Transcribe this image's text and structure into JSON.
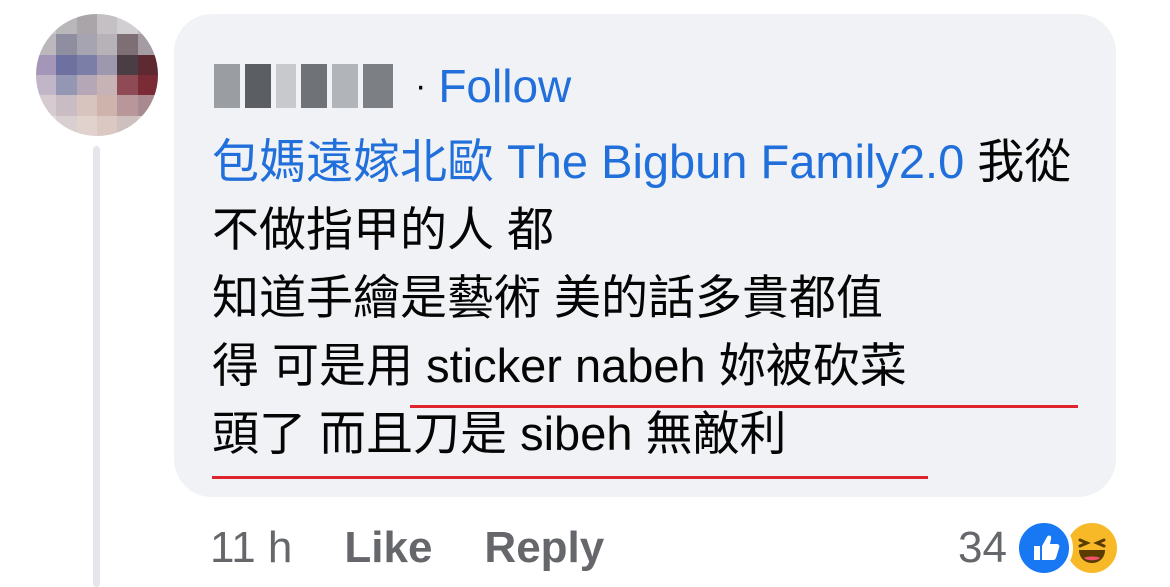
{
  "comment": {
    "follow_label": "Follow",
    "separator": "·",
    "mention": "包媽遠嫁北歐 The Bigbun Family2.0",
    "text_line1": " 我從不做指甲的人 都",
    "text_line2": "知道手繪是藝術 美的話多貴都值",
    "text_line3_a": "得 可是",
    "text_line3_b": "用 sticker nabeh 妳被砍菜",
    "text_line4": "頭了 而且刀是 sibeh 無敵利"
  },
  "actions": {
    "timestamp": "11 h",
    "like_label": "Like",
    "reply_label": "Reply"
  },
  "reactions": {
    "count": "34",
    "types": [
      "like-icon",
      "haha-icon"
    ]
  },
  "colors": {
    "link": "#216fdb",
    "bubble": "#f0f2f5",
    "secondary_text": "#65676b",
    "underline": "#e0242b",
    "like_blue": "#1877f2",
    "haha_yellow": "#f7b928"
  }
}
